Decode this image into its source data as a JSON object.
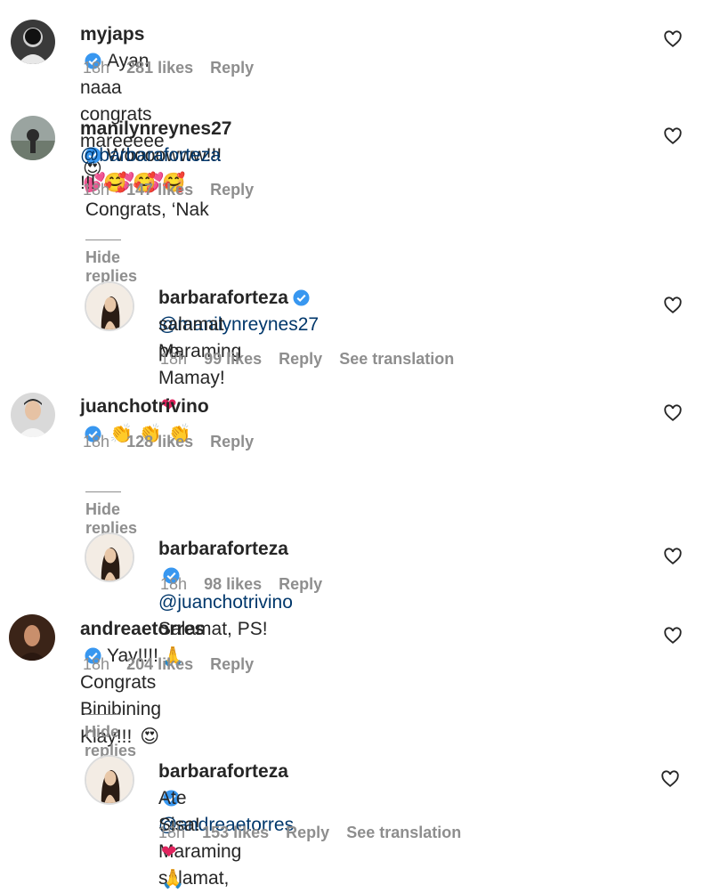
{
  "comments": [
    {
      "username": "myjaps",
      "text": "Ayan naaa congrats mareeeee",
      "emoji": "😍",
      "time": "18h",
      "likes": "281 likes",
      "reply": "Reply"
    },
    {
      "username": "manilynreynes27",
      "text_line1": "Woooowww!!!",
      "emoji_hearts": "💕 💕 💕",
      "text_line1b": "Congrats, ‘Nak",
      "mention": "@barbaraforteza",
      "text_line2": "!!!",
      "emoji_hug": "🥰 🥰 🥰",
      "time": "18h",
      "likes": "147 likes",
      "reply": "Reply",
      "hide_replies": "Hide replies",
      "reply_item": {
        "username": "barbaraforteza",
        "mention": "@manilynreynes27",
        "text_line1": "Maraming",
        "text_line2": "salamat po, Mamay!",
        "emoji": "❤",
        "time": "18h",
        "likes": "99 likes",
        "reply": "Reply",
        "translate": "See translation"
      }
    },
    {
      "username": "juanchotrivino",
      "emoji": "👏 👏 👏",
      "time": "18h",
      "likes": "128 likes",
      "reply": "Reply",
      "hide_replies": "Hide replies",
      "reply_item": {
        "username": "barbaraforteza",
        "mention": "@juanchotrivino",
        "text": "Salamat, PS!",
        "emoji": "🙏",
        "time": "18h",
        "likes": "98 likes",
        "reply": "Reply"
      }
    },
    {
      "username": "andreaetorres",
      "text": "Yay!!!! Congrats Binibining Klay!!!",
      "emoji": "😍",
      "time": "18h",
      "likes": "204 likes",
      "reply": "Reply",
      "hide_replies": "Hide replies",
      "reply_item": {
        "username": "barbaraforteza",
        "mention": "@andreaetorres",
        "text_line1": "Maraming salamat,",
        "text_line2": "Ate Sisa!",
        "emoji": "❤ 🙏",
        "time": "18h",
        "likes": "153 likes",
        "reply": "Reply",
        "translate": "See translation"
      }
    }
  ],
  "icons": {
    "verified": "verified-badge-icon",
    "like": "heart-outline-icon"
  },
  "colors": {
    "verified": "#3897f0",
    "mention": "#00376b",
    "meta": "#8e8e8e",
    "heart": "#e0245e"
  }
}
